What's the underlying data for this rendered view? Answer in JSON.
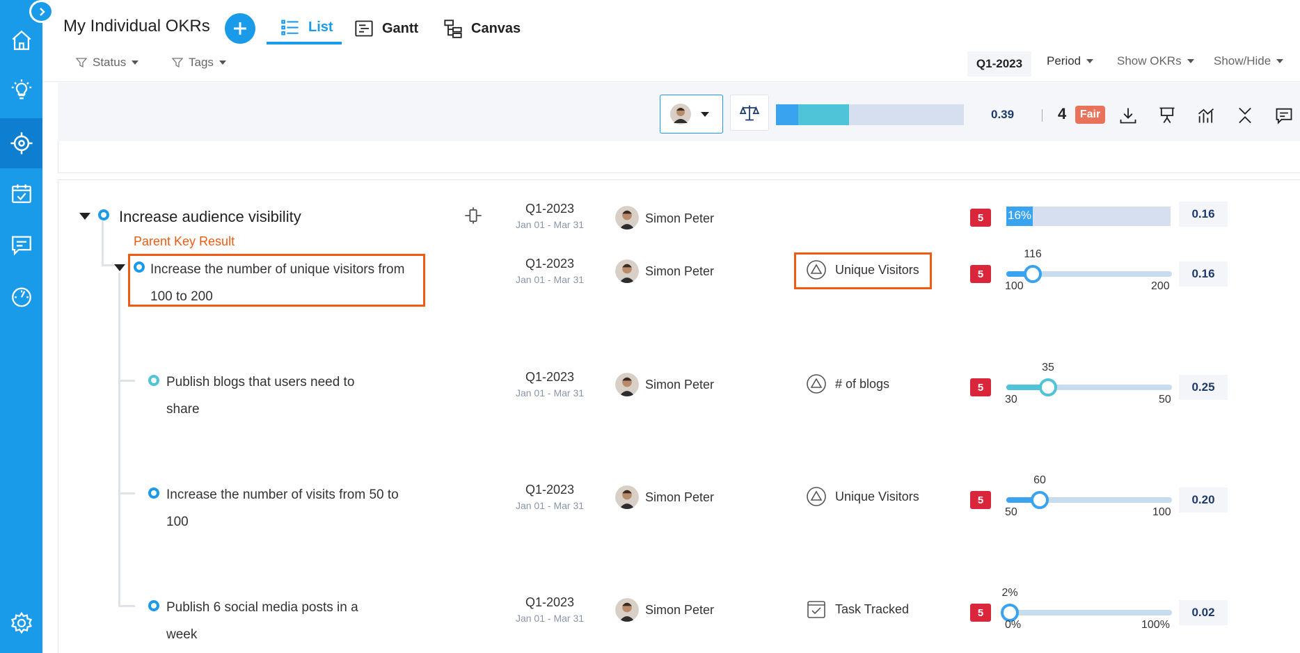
{
  "app": {
    "page_title": "My Individual OKRs",
    "add_label": "+",
    "tabs": [
      {
        "label": "List",
        "active": true,
        "icon": "list-icon"
      },
      {
        "label": "Gantt",
        "active": false,
        "icon": "gantt-icon"
      },
      {
        "label": "Canvas",
        "active": false,
        "icon": "canvas-icon"
      }
    ],
    "filters": {
      "status": "Status",
      "tags": "Tags"
    },
    "controls": {
      "quarter": "Q1-2023",
      "period": "Period",
      "show_okrs": "Show OKRs",
      "show_hide": "Show/Hide"
    }
  },
  "sidebar": {
    "items": [
      {
        "icon": "home-icon"
      },
      {
        "icon": "lightbulb-icon"
      },
      {
        "icon": "target-icon",
        "active": true
      },
      {
        "icon": "calendar-check-icon"
      },
      {
        "icon": "chat-icon"
      },
      {
        "icon": "dashboard-icon"
      },
      {
        "icon": "settings-icon"
      }
    ]
  },
  "summary": {
    "progress_fraction": 0.39,
    "score": "0.39",
    "count": "4",
    "rating": "Fair",
    "colors": {
      "accent": "#1a9bea",
      "rating": "#e8725a",
      "confidence": "#d9263a",
      "highlight": "#f05a12"
    }
  },
  "objective": {
    "title": "Increase audience visibility",
    "period": "Q1-2023",
    "dates": "Jan 01 - Mar 31",
    "owner": "Simon Peter",
    "confidence": "5",
    "progress_label": "16%",
    "progress_fraction": 0.16,
    "score": "0.16"
  },
  "annotation": "Parent Key Result",
  "key_results": [
    {
      "title": "Increase the number of unique visitors from 100 to 200",
      "period": "Q1-2023",
      "dates": "Jan 01 - Mar 31",
      "owner": "Simon Peter",
      "metric": "Unique Visitors",
      "metric_icon": "triangle-icon",
      "confidence": "5",
      "current": "116",
      "start": "100",
      "target": "200",
      "progress_fraction": 0.16,
      "score": "0.16"
    },
    {
      "title": "Publish blogs that users need to share",
      "period": "Q1-2023",
      "dates": "Jan 01 - Mar 31",
      "owner": "Simon Peter",
      "metric": "# of blogs",
      "metric_icon": "triangle-icon",
      "confidence": "5",
      "current": "35",
      "start": "30",
      "target": "50",
      "progress_fraction": 0.25,
      "score": "0.25"
    },
    {
      "title": "Increase the number of visits from 50 to 100",
      "period": "Q1-2023",
      "dates": "Jan 01 - Mar 31",
      "owner": "Simon Peter",
      "metric": "Unique Visitors",
      "metric_icon": "triangle-icon",
      "confidence": "5",
      "current": "60",
      "start": "50",
      "target": "100",
      "progress_fraction": 0.2,
      "score": "0.20"
    },
    {
      "title": "Publish 6 social media posts in a week",
      "period": "Q1-2023",
      "dates": "Jan 01 - Mar 31",
      "owner": "Simon Peter",
      "metric": "Task Tracked",
      "metric_icon": "task-icon",
      "confidence": "5",
      "current": "2%",
      "start": "0%",
      "target": "100%",
      "progress_fraction": 0.02,
      "score": "0.02"
    }
  ]
}
